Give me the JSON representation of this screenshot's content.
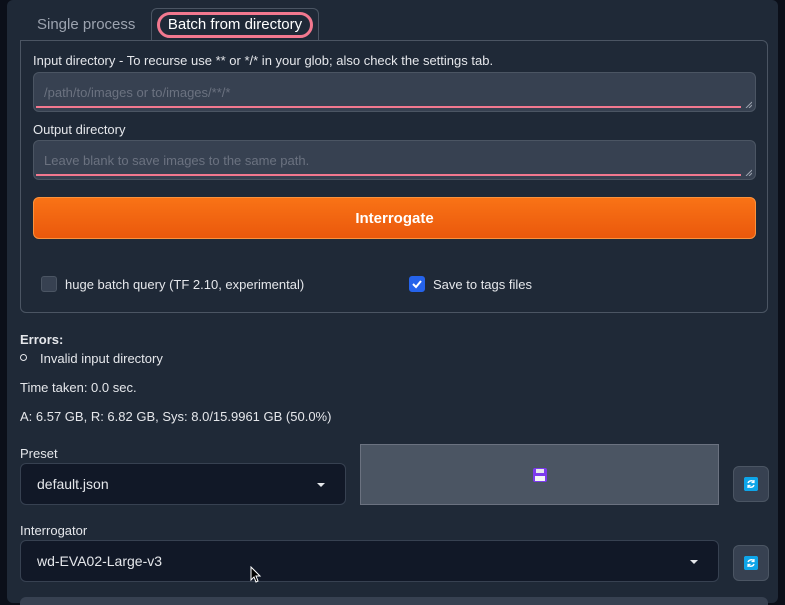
{
  "tabs": {
    "single": "Single process",
    "batch": "Batch from directory"
  },
  "batch": {
    "input_label": "Input directory - To recurse use ** or */* in your glob; also check the settings tab.",
    "input_placeholder": "/path/to/images or to/images/**/*",
    "output_label": "Output directory",
    "output_placeholder": "Leave blank to save images to the same path.",
    "interrogate_label": "Interrogate",
    "huge_batch_label": "huge batch query (TF 2.10, experimental)",
    "huge_batch_checked": false,
    "save_tags_label": "Save to tags files",
    "save_tags_checked": true
  },
  "status": {
    "errors_title": "Errors:",
    "error_item": "Invalid input directory",
    "time_taken": "Time taken: 0.0 sec.",
    "memory": "A: 6.57 GB, R: 6.82 GB, Sys: 8.0/15.9961 GB (50.0%)"
  },
  "preset": {
    "label": "Preset",
    "value": "default.json"
  },
  "interrogator": {
    "label": "Interrogator",
    "value": "wd-EVA02-Large-v3"
  },
  "icons": {
    "save": "floppy-disk-icon",
    "refresh": "refresh-icon"
  },
  "colors": {
    "accent": "#f97316",
    "highlight": "#f2788f",
    "checkbox": "#2563eb"
  }
}
